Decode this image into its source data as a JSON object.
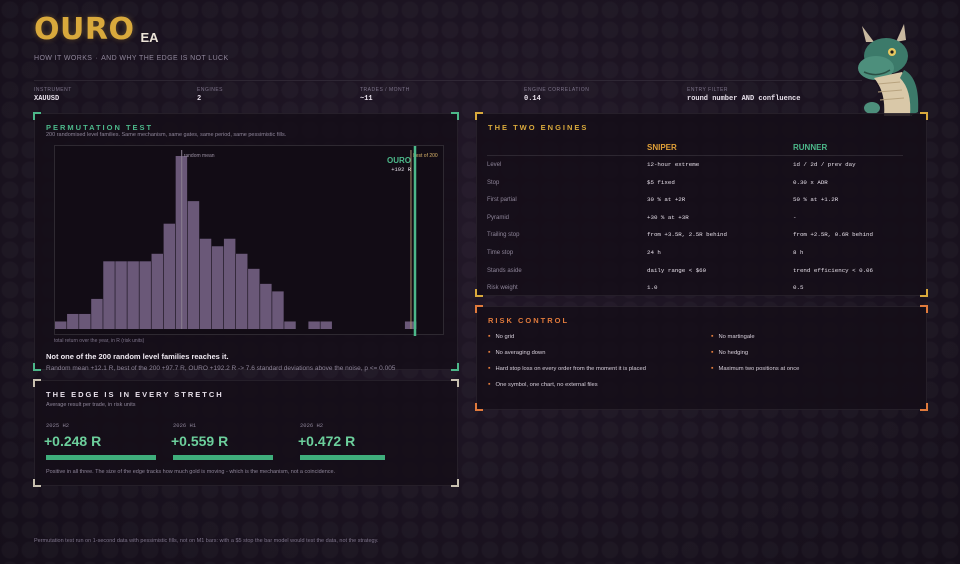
{
  "header": {
    "title": "OURO",
    "suffix": "EA",
    "tagline_a": "HOW IT WORKS",
    "tagline_sep": "·",
    "tagline_b": "AND WHY THE EDGE IS NOT LUCK"
  },
  "stats": [
    {
      "label": "INSTRUMENT",
      "value": "XAUUSD"
    },
    {
      "label": "ENGINES",
      "value": "2"
    },
    {
      "label": "TRADES / MONTH",
      "value": "~11"
    },
    {
      "label": "ENGINE CORRELATION",
      "value": "0.14"
    },
    {
      "label": "ENTRY FILTER",
      "value": "round number AND confluence"
    }
  ],
  "permutation": {
    "title": "PERMUTATION TEST",
    "subtitle": "200 randomised level families. Same mechanism, same gates, same period, same pessimistic fills.",
    "caption": "total return over the year, in R (risk units)",
    "headline": "Not one of the 200 random level families reaches it.",
    "detail": "Random mean +12.1 R,  best of the 200 +97.7 R,  OURO +192.2 R   ->   7.6 standard deviations above the noise,  p <= 0.005"
  },
  "chart_data": {
    "type": "bar",
    "title": "",
    "xlabel": "total return over the year, in R (risk units)",
    "ylabel": "",
    "bins": [
      1,
      2,
      2,
      4,
      9,
      9,
      9,
      9,
      10,
      14,
      23,
      17,
      12,
      11,
      12,
      10,
      8,
      6,
      5,
      1,
      0,
      1,
      1,
      0,
      0,
      0,
      0,
      0,
      0,
      1
    ],
    "markers": [
      {
        "label": "random mean",
        "bin_position": 10.5
      },
      {
        "label": "best of 200",
        "bin_position": 29.5
      }
    ],
    "ouro": {
      "label": "OURO",
      "value_label": "+192 R"
    },
    "colors": {
      "bars": "#6a5878",
      "marker": "#8a7f90",
      "best": "#a8906a",
      "ouro": "#4cb88a"
    }
  },
  "edge": {
    "title": "THE EDGE IS IN EVERY STRETCH",
    "subtitle": "Average result per trade, in risk units",
    "periods": [
      {
        "label": "2025 H2",
        "value": "+0.248 R",
        "bar_fraction": 0.44
      },
      {
        "label": "2026 H1",
        "value": "+0.559 R",
        "bar_fraction": 1.0
      },
      {
        "label": "2026 H2",
        "value": "+0.472 R",
        "bar_fraction": 0.84
      }
    ],
    "footer": "Positive in all three. The size of the edge tracks how much gold is moving - which is the mechanism, not a coincidence."
  },
  "engines": {
    "title": "THE TWO ENGINES",
    "col1": "SNIPER",
    "col2": "RUNNER",
    "rows": [
      {
        "label": "Level",
        "sniper": "12-hour extreme",
        "runner": "1d / 2d / prev day"
      },
      {
        "label": "Stop",
        "sniper": "$5 fixed",
        "runner": "0.30 x ADR"
      },
      {
        "label": "First partial",
        "sniper": "30 % at +2R",
        "runner": "50 % at +1.2R"
      },
      {
        "label": "Pyramid",
        "sniper": "+30 % at +3R",
        "runner": "-"
      },
      {
        "label": "Trailing stop",
        "sniper": "from +3.5R, 2.5R behind",
        "runner": "from +2.5R, 0.6R behind"
      },
      {
        "label": "Time stop",
        "sniper": "24 h",
        "runner": "8 h"
      },
      {
        "label": "Stands aside",
        "sniper": "daily range < $60",
        "runner": "trend efficiency < 0.06"
      },
      {
        "label": "Risk weight",
        "sniper": "1.0",
        "runner": "0.5"
      }
    ]
  },
  "risk": {
    "title": "RISK CONTROL",
    "left": [
      "No grid",
      "No averaging down",
      "Hard stop loss on every order from the moment it is placed",
      "One symbol, one chart, no external files"
    ],
    "right": [
      "No martingale",
      "No hedging",
      "Maximum two positions at once"
    ]
  },
  "footnote": "Permutation test run on 1-second data with pessimistic fills, not on M1 bars: with a $5 stop the bar model would test the data, not the strategy.",
  "colors": {
    "gold": "#d9a93c",
    "green": "#4cb88a",
    "orange": "#e07a3c",
    "background": "#1a1320"
  }
}
